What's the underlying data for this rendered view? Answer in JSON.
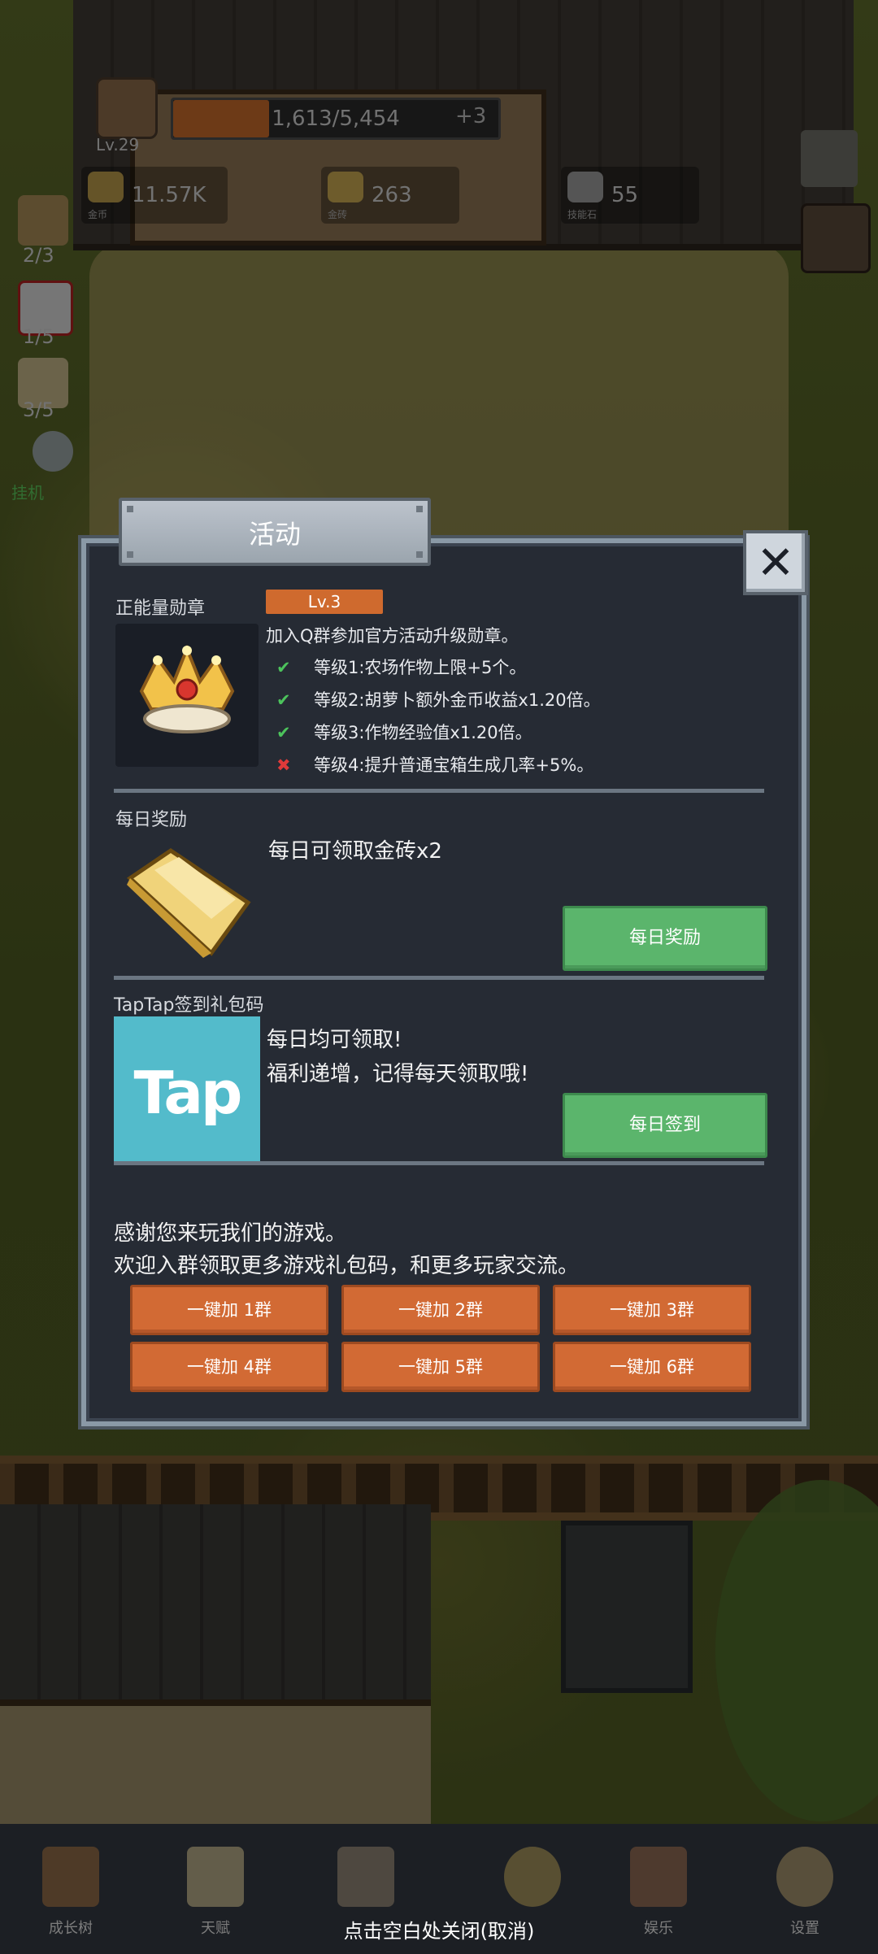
{
  "hud": {
    "level": "Lv.29",
    "xp_text": "1,613/5,454",
    "xp_fraction": 0.296,
    "xp_bonus": "+3",
    "resources": [
      {
        "icon": "gold-coin-icon",
        "value": "11.57K",
        "name": "金币"
      },
      {
        "icon": "gold-brick-icon",
        "value": "263",
        "name": "金砖"
      },
      {
        "icon": "skill-stone-icon",
        "value": "55",
        "name": "技能石"
      }
    ],
    "side": [
      {
        "icon": "candle-icon",
        "count": "2/3"
      },
      {
        "icon": "dice-icon",
        "count": "1/5"
      },
      {
        "icon": "jar-icon",
        "count": "3/5"
      }
    ],
    "auto_label": "挂机"
  },
  "dialog": {
    "title": "活动",
    "close_icon": "close-icon",
    "badge": {
      "section_label": "正能量勋章",
      "level_tag": "Lv.3",
      "description": "加入Q群参加官方活动升级勋章。",
      "levels": [
        {
          "text": "等级1:农场作物上限+5个。",
          "achieved": true,
          "mark": "✔"
        },
        {
          "text": "等级2:胡萝卜额外金币收益x1.20倍。",
          "achieved": true,
          "mark": "✔"
        },
        {
          "text": "等级3:作物经验值x1.20倍。",
          "achieved": true,
          "mark": "✔"
        },
        {
          "text": "等级4:提升普通宝箱生成几率+5%。",
          "achieved": false,
          "mark": "✖"
        }
      ]
    },
    "daily": {
      "section_label": "每日奖励",
      "text": "每日可领取金砖x2",
      "button": "每日奖励"
    },
    "taptap": {
      "section_label": "TapTap签到礼包码",
      "logo_text": "Tap",
      "line1": "每日均可领取!",
      "line2": "福利递增，记得每天领取哦!",
      "button": "每日签到"
    },
    "thanks_line1": "感谢您来玩我们的游戏。",
    "thanks_line2": "欢迎入群领取更多游戏礼包码，和更多玩家交流。",
    "group_buttons": [
      "一键加 1群",
      "一键加 2群",
      "一键加 3群",
      "一键加 4群",
      "一键加 5群",
      "一键加 6群"
    ]
  },
  "nav": {
    "items": [
      {
        "label": "成长树",
        "icon": "book-icon"
      },
      {
        "label": "天赋",
        "icon": "scroll-icon"
      },
      {
        "label": "",
        "icon": "map-icon"
      },
      {
        "label": "",
        "icon": "key-icon"
      },
      {
        "label": "娱乐",
        "icon": "flag-icon"
      },
      {
        "label": "设置",
        "icon": "gear-icon"
      }
    ],
    "close_hint": "点击空白处关闭(取消)"
  },
  "colors": {
    "panel_bg": "#262b34",
    "panel_border": "#8a99a6",
    "orange": "#d26a34",
    "green": "#5bb56c",
    "tap_blue": "#53bbcb"
  }
}
